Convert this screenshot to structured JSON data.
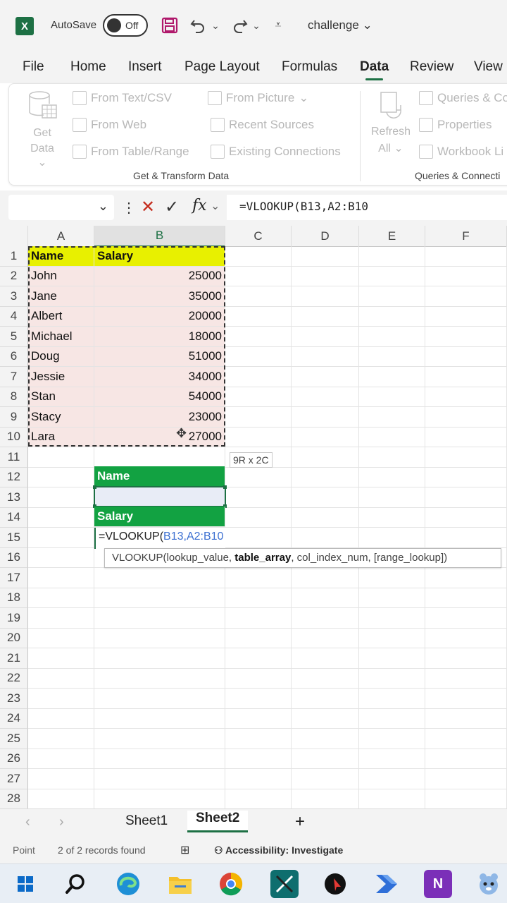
{
  "titlebar": {
    "app_icon_letter": "X",
    "autosave_label": "AutoSave",
    "autosave_state": "Off",
    "doc_title": "challenge"
  },
  "menu": {
    "tabs": [
      "File",
      "Home",
      "Insert",
      "Page Layout",
      "Formulas",
      "Data",
      "Review",
      "View"
    ],
    "active": "Data"
  },
  "ribbon": {
    "get_data": [
      "Get",
      "Data"
    ],
    "from_text_csv": "From Text/CSV",
    "from_web": "From Web",
    "from_table_range": "From Table/Range",
    "from_picture": "From Picture",
    "recent_sources": "Recent Sources",
    "existing_connections": "Existing Connections",
    "group1_label": "Get & Transform Data",
    "refresh_all": [
      "Refresh",
      "All"
    ],
    "queries_connections": "Queries & Co",
    "properties": "Properties",
    "workbook_links": "Workbook Li",
    "group2_label": "Queries & Connecti"
  },
  "formula_bar": {
    "name_box": "",
    "fx_label": "fx",
    "formula": "=VLOOKUP(B13,A2:B10"
  },
  "columns": [
    "A",
    "B",
    "C",
    "D",
    "E",
    "F"
  ],
  "rows": [
    "1",
    "2",
    "3",
    "4",
    "5",
    "6",
    "7",
    "8",
    "9",
    "10",
    "11",
    "12",
    "13",
    "14",
    "15",
    "16",
    "17",
    "18",
    "19",
    "20",
    "21",
    "22",
    "23",
    "24",
    "25",
    "26",
    "27",
    "28"
  ],
  "table": {
    "headers": [
      "Name",
      "Salary"
    ],
    "records": [
      {
        "name": "John",
        "salary": "25000"
      },
      {
        "name": "Jane",
        "salary": "35000"
      },
      {
        "name": "Albert",
        "salary": "20000"
      },
      {
        "name": "Michael",
        "salary": "18000"
      },
      {
        "name": "Doug",
        "salary": "51000"
      },
      {
        "name": "Jessie",
        "salary": "34000"
      },
      {
        "name": "Stan",
        "salary": "54000"
      },
      {
        "name": "Stacy",
        "salary": "23000"
      },
      {
        "name": "Lara",
        "salary": "27000"
      }
    ]
  },
  "lookup": {
    "name_label": "Name",
    "name_value": "",
    "salary_label": "Salary",
    "edit_prefix": "=VLOOKUP(",
    "edit_ref": "B13,A2:B10"
  },
  "range_tip": "9R x 2C",
  "function_tip": {
    "prefix": "VLOOKUP(lookup_value, ",
    "bold": "table_array",
    "suffix": ", col_index_num, [range_lookup])"
  },
  "sheets": {
    "tabs": [
      "Sheet1",
      "Sheet2"
    ],
    "active": "Sheet2",
    "add": "+"
  },
  "status": {
    "mode": "Point",
    "records": "2 of 2 records found",
    "accessibility": "Accessibility: Investigate"
  },
  "taskbar": {
    "onenote_letter": "N"
  },
  "colors": {
    "excel_green": "#1d7044",
    "header_yellow": "#e8f000",
    "lookup_green": "#12a242",
    "data_pink": "#f7e6e4"
  }
}
